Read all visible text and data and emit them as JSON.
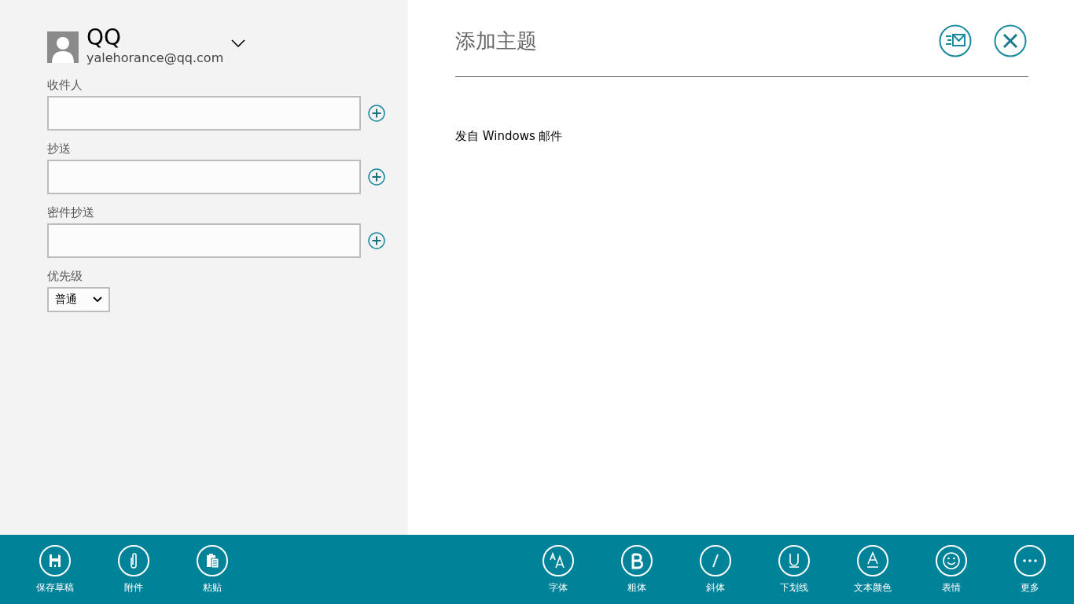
{
  "account": {
    "name": "QQ",
    "email": "yalehorance@qq.com"
  },
  "recipients": [
    {
      "label": "收件人"
    },
    {
      "label": "抄送"
    },
    {
      "label": "密件抄送"
    }
  ],
  "priority": {
    "label": "优先级",
    "value": "普通"
  },
  "subject": {
    "placeholder": "添加主题"
  },
  "body": "发自 Windows 邮件",
  "app_bar": {
    "left": [
      {
        "kind": "save",
        "label": "保存草稿"
      },
      {
        "kind": "attach",
        "label": "附件"
      },
      {
        "kind": "paste",
        "label": "粘贴"
      }
    ],
    "right": [
      {
        "kind": "font",
        "label": "字体"
      },
      {
        "kind": "bold",
        "label": "粗体"
      },
      {
        "kind": "italic",
        "label": "斜体"
      },
      {
        "kind": "underline",
        "label": "下划线"
      },
      {
        "kind": "color",
        "label": "文本颜色"
      },
      {
        "kind": "emoji",
        "label": "表情"
      },
      {
        "kind": "more",
        "label": "更多"
      }
    ]
  }
}
